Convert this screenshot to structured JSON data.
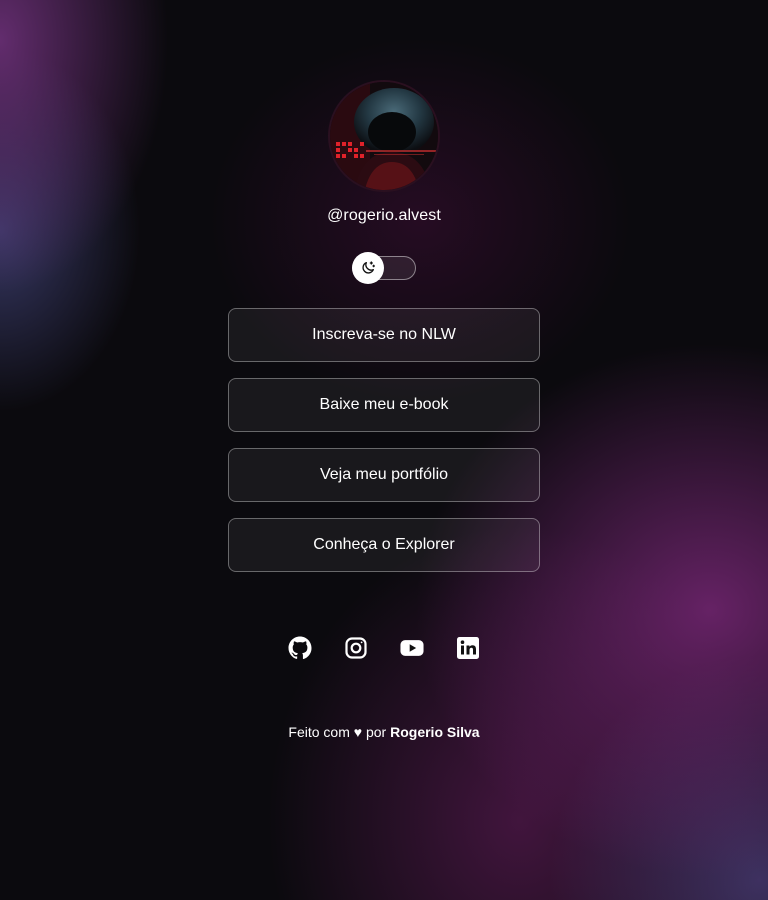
{
  "profile": {
    "username": "@rogerio.alvest",
    "avatar_alt": "Foto de perfil"
  },
  "theme_switch": {
    "icon": "moon-stars-icon",
    "state": "dark"
  },
  "links": [
    {
      "label": "Inscreva-se no NLW"
    },
    {
      "label": "Baixe meu e-book"
    },
    {
      "label": "Veja meu portfólio"
    },
    {
      "label": "Conheça o Explorer"
    }
  ],
  "social": [
    {
      "icon": "github-icon"
    },
    {
      "icon": "instagram-icon"
    },
    {
      "icon": "youtube-icon"
    },
    {
      "icon": "linkedin-icon"
    }
  ],
  "footer": {
    "prefix": "Feito com",
    "heart": "♥",
    "middle": "por",
    "author": "Rogerio Silva"
  },
  "colors": {
    "text": "#ffffff",
    "background": "#0b0a0e",
    "accent_purple": "#842a82",
    "button_border": "rgba(255,255,255,0.35)"
  }
}
